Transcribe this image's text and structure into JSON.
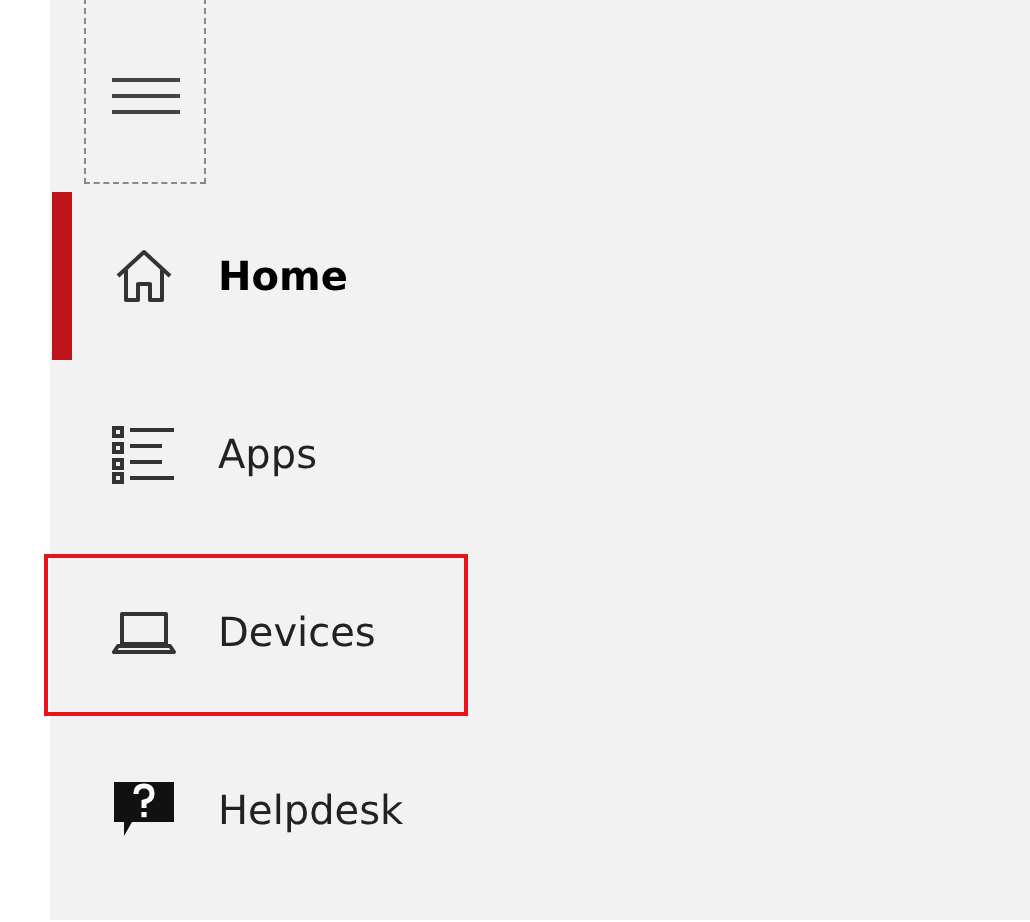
{
  "nav_items": [
    {
      "kind": "home",
      "label": "Home",
      "selected": true,
      "highlighted": false
    },
    {
      "kind": "apps",
      "label": "Apps",
      "selected": false,
      "highlighted": false
    },
    {
      "kind": "devices",
      "label": "Devices",
      "selected": false,
      "highlighted": true
    },
    {
      "kind": "helpdesk",
      "label": "Helpdesk",
      "selected": false,
      "highlighted": false
    }
  ]
}
